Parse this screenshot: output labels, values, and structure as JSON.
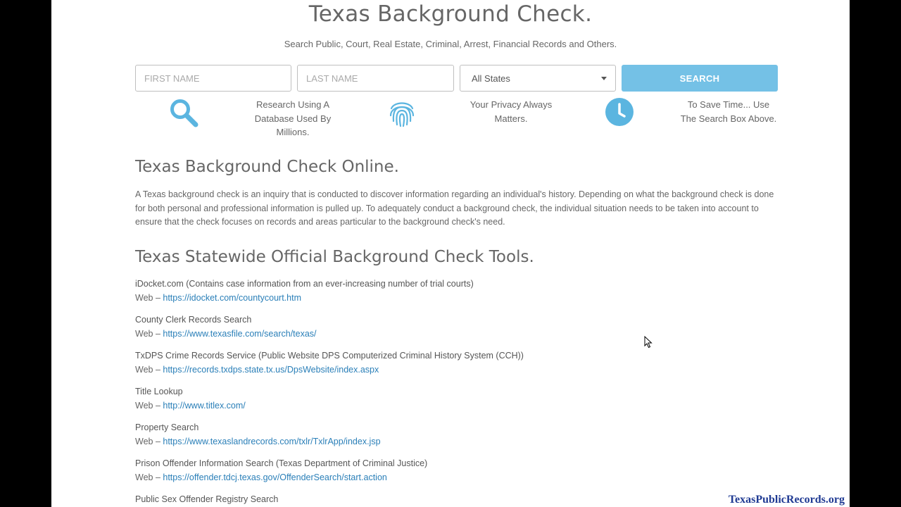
{
  "header": {
    "title": "Texas Background Check.",
    "subtitle": "Search Public, Court, Real Estate, Criminal, Arrest, Financial Records and Others."
  },
  "search": {
    "first_name_placeholder": "FIRST NAME",
    "last_name_placeholder": "LAST NAME",
    "state_selected": "All States",
    "button_label": "SEARCH"
  },
  "features": [
    {
      "icon": "magnifier-icon",
      "text": "Research Using A Database Used By Millions."
    },
    {
      "icon": "fingerprint-icon",
      "text": "Your Privacy Always Matters."
    },
    {
      "icon": "clock-icon",
      "text": "To Save Time... Use The Search Box Above."
    }
  ],
  "section1": {
    "heading": "Texas Background Check Online.",
    "body": "A Texas background check is an inquiry that is conducted to discover information regarding an individual's history. Depending on what the background check is done for both personal and professional information is pulled up. To adequately conduct a background check, the individual situation needs to be taken into account to ensure that the check focuses on records and areas particular to the background check's need."
  },
  "section2": {
    "heading": "Texas Statewide Official Background Check Tools.",
    "web_prefix": "Web – ",
    "tools": [
      {
        "name": "iDocket.com (Contains case information from an ever-increasing number of trial courts)",
        "url": "https://idocket.com/countycourt.htm"
      },
      {
        "name": "County Clerk Records Search",
        "url": "https://www.texasfile.com/search/texas/"
      },
      {
        "name": "TxDPS Crime Records Service (Public Website DPS Computerized Criminal History System (CCH))",
        "url": "https://records.txdps.state.tx.us/DpsWebsite/index.aspx"
      },
      {
        "name": "Title Lookup",
        "url": "http://www.titlex.com/"
      },
      {
        "name": "Property Search",
        "url": "https://www.texaslandrecords.com/txlr/TxlrApp/index.jsp"
      },
      {
        "name": "Prison Offender Information Search (Texas Department of Criminal Justice)",
        "url": "https://offender.tdcj.texas.gov/OffenderSearch/start.action"
      },
      {
        "name": "Public Sex Offender Registry Search",
        "url": ""
      }
    ]
  },
  "watermark": "TexasPublicRecords.org",
  "colors": {
    "accent": "#74c1e6",
    "icon": "#5bb5e0",
    "link": "#2a7fb8",
    "text": "#666666",
    "watermark": "#1f3a93"
  }
}
